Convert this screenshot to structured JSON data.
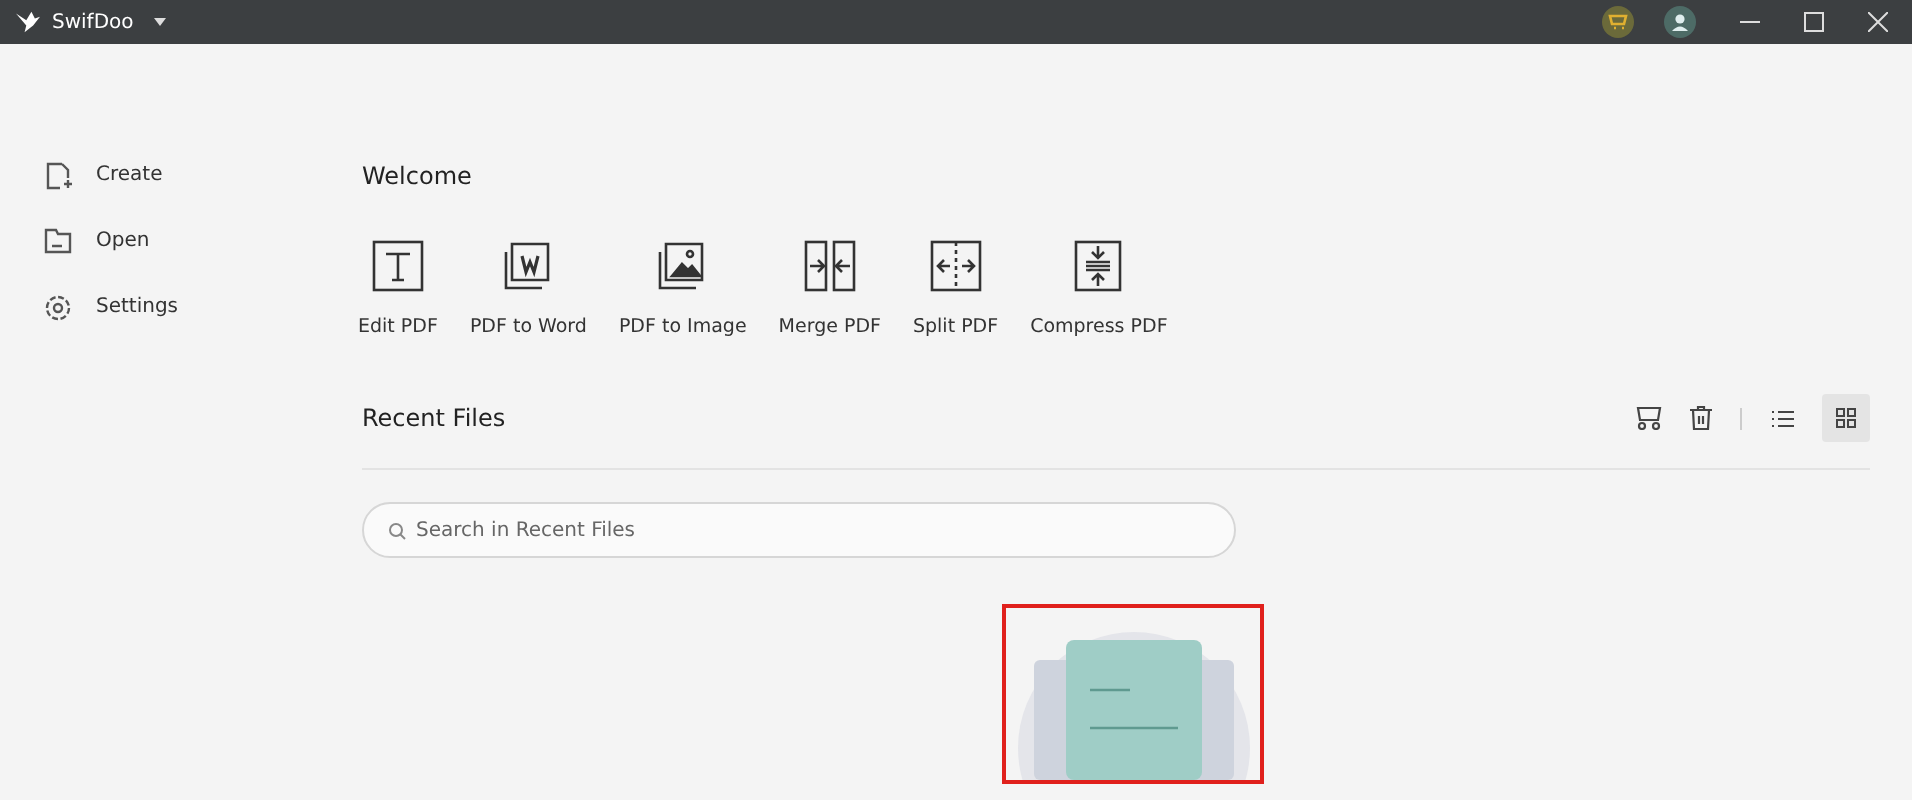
{
  "window": {
    "title": "SwifDoo"
  },
  "sidebar": {
    "items": [
      {
        "label": "Create",
        "kind": "create"
      },
      {
        "label": "Open",
        "kind": "open"
      },
      {
        "label": "Settings",
        "kind": "settings"
      }
    ]
  },
  "welcome": {
    "title": "Welcome",
    "tools": [
      {
        "label": "Edit PDF",
        "kind": "edit"
      },
      {
        "label": "PDF to Word",
        "kind": "word"
      },
      {
        "label": "PDF to Image",
        "kind": "image"
      },
      {
        "label": "Merge PDF",
        "kind": "merge"
      },
      {
        "label": "Split PDF",
        "kind": "split"
      },
      {
        "label": "Compress PDF",
        "kind": "compress"
      }
    ]
  },
  "recent_files": {
    "title": "Recent Files",
    "view_buttons": [
      {
        "kind": "list",
        "selected": false
      },
      {
        "kind": "grid",
        "selected": true
      }
    ],
    "search": {
      "placeholder": "Search in Recent Files"
    },
    "highlighted": true
  }
}
